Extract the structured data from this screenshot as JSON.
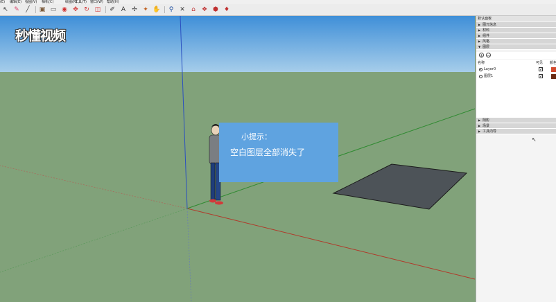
{
  "menubar": {
    "items": [
      "(E)",
      "编辑(E)",
      "视图(V)",
      "相机(C)",
      "绘图(R)",
      "工具(T)",
      "窗口(W)",
      "帮助(H)"
    ]
  },
  "toolbar": {
    "icons": [
      {
        "name": "select-arrow-icon",
        "glyph": "↖",
        "color": "#222222"
      },
      {
        "name": "eraser-icon",
        "glyph": "✎",
        "color": "#d9436a"
      },
      {
        "name": "line-icon",
        "glyph": "╱",
        "color": "#444444"
      },
      {
        "name": "paint-bucket-icon",
        "glyph": "▣",
        "color": "#7a5a3a"
      },
      {
        "name": "rectangle-icon",
        "glyph": "▭",
        "color": "#5a5a5a"
      },
      {
        "name": "push-pull-icon",
        "glyph": "◉",
        "color": "#d03030"
      },
      {
        "name": "move-icon",
        "glyph": "✥",
        "color": "#d03030"
      },
      {
        "name": "rotate-icon",
        "glyph": "↻",
        "color": "#d03030"
      },
      {
        "name": "offset-icon",
        "glyph": "◫",
        "color": "#d03030"
      },
      {
        "name": "tape-measure-icon",
        "glyph": "✐",
        "color": "#333333"
      },
      {
        "name": "text-icon",
        "glyph": "A",
        "color": "#333333"
      },
      {
        "name": "axes-icon",
        "glyph": "✢",
        "color": "#333333"
      },
      {
        "name": "orbit-icon",
        "glyph": "✦",
        "color": "#c06020"
      },
      {
        "name": "pan-icon",
        "glyph": "✋",
        "color": "#c08030"
      },
      {
        "name": "zoom-icon",
        "glyph": "⚲",
        "color": "#2050a0"
      },
      {
        "name": "zoom-extents-icon",
        "glyph": "✕",
        "color": "#333333"
      },
      {
        "name": "warehouse-icon",
        "glyph": "⌂",
        "color": "#c03030"
      },
      {
        "name": "components-icon",
        "glyph": "❖",
        "color": "#c03030"
      },
      {
        "name": "share-model-icon",
        "glyph": "⬢",
        "color": "#c03030"
      },
      {
        "name": "extension-icon",
        "glyph": "♦",
        "color": "#c03030"
      }
    ]
  },
  "watermark": {
    "text": "秒懂视频"
  },
  "tip": {
    "title": "小提示：",
    "body": "空白图层全部消失了"
  },
  "tray": {
    "title": "默认面板",
    "sections": [
      {
        "label": "图元信息",
        "arrow": "▶"
      },
      {
        "label": "材料",
        "arrow": "▶"
      },
      {
        "label": "组件",
        "arrow": "▶"
      },
      {
        "label": "风格",
        "arrow": "▶"
      },
      {
        "label": "图层",
        "arrow": "▼"
      }
    ],
    "layers": {
      "add_glyph": "+",
      "remove_glyph": "−",
      "columns": {
        "name": "名称",
        "visible": "可见",
        "color": "颜色"
      },
      "rows": [
        {
          "name": "Layer0",
          "active": true,
          "visible_mark": "✓",
          "swatch": "#d24a2e"
        },
        {
          "name": "图层1",
          "active": false,
          "visible_mark": "✓",
          "swatch": "#6b2a12"
        }
      ]
    },
    "bottom_sections": [
      {
        "label": "阴影",
        "arrow": "▶"
      },
      {
        "label": "场景",
        "arrow": "▶"
      },
      {
        "label": "工具向导",
        "arrow": "▶"
      }
    ]
  },
  "colors": {
    "sky_top": "#3f8fd8",
    "ground": "#81a27a",
    "tip_bg": "#5fa3e0",
    "rect_fill": "#4d5358",
    "axis_red": "#b03a2a",
    "axis_green": "#2e8a30",
    "axis_blue": "#2a4fc0"
  }
}
